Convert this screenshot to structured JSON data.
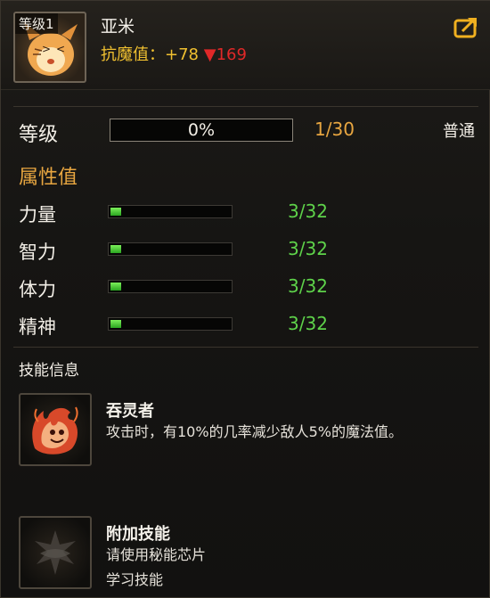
{
  "header": {
    "level_badge": "等级1",
    "pet_name": "亚米",
    "resist_label": "抗魔值：",
    "resist_bonus": "+78",
    "resist_down": "▼169"
  },
  "level": {
    "label": "等级",
    "percent_text": "0%",
    "count": "1/30",
    "grade": "普通"
  },
  "attributes": {
    "title": "属性值",
    "items": [
      {
        "label": "力量",
        "value": "3/32",
        "fill": 0.09
      },
      {
        "label": "智力",
        "value": "3/32",
        "fill": 0.09
      },
      {
        "label": "体力",
        "value": "3/32",
        "fill": 0.09
      },
      {
        "label": "精神",
        "value": "3/32",
        "fill": 0.09
      }
    ]
  },
  "skills": {
    "title": "技能信息",
    "items": [
      {
        "name": "吞灵者",
        "desc_line1": "攻击时，有10%的几率减少敌人5%的魔法值。",
        "desc_line2": ""
      },
      {
        "name": "附加技能",
        "desc_line1": "请使用秘能芯片",
        "desc_line2": "学习技能"
      }
    ]
  },
  "colors": {
    "accent_gold": "#e8a640",
    "resist_yellow": "#f0c030",
    "down_red": "#e02828",
    "stat_green": "#5ed24a"
  }
}
